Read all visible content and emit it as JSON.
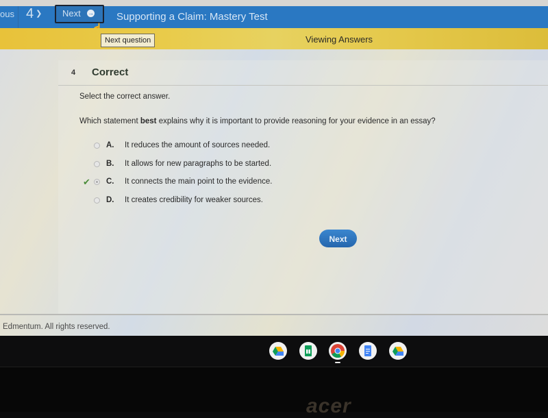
{
  "navbar": {
    "previous_label": "ous",
    "question_number": "4",
    "next_label": "Next",
    "title": "Supporting a Claim: Mastery Test",
    "tooltip": "Next question"
  },
  "banner": {
    "mode": "Viewing Answers"
  },
  "question": {
    "number": "4",
    "status": "Correct",
    "prompt": "Select the correct answer.",
    "text_before": "Which statement ",
    "text_bold": "best",
    "text_after": " explains why it is important to provide reasoning for your evidence in an essay?",
    "choices": [
      {
        "letter": "A.",
        "text": "It reduces the amount of sources needed.",
        "selected": false,
        "correct": false
      },
      {
        "letter": "B.",
        "text": "It allows for new paragraphs to be started.",
        "selected": false,
        "correct": false
      },
      {
        "letter": "C.",
        "text": "It connects the main point to the evidence.",
        "selected": true,
        "correct": true
      },
      {
        "letter": "D.",
        "text": "It creates credibility for weaker sources.",
        "selected": false,
        "correct": false
      }
    ],
    "next_button": "Next"
  },
  "footer": {
    "copyright": "Edmentum. All rights reserved."
  },
  "shelf": {
    "apps": [
      {
        "name": "google-drive-icon"
      },
      {
        "name": "google-sheets-icon"
      },
      {
        "name": "chrome-icon",
        "active": true
      },
      {
        "name": "google-docs-icon"
      },
      {
        "name": "google-drive-icon"
      }
    ]
  },
  "hardware": {
    "brand": "acer"
  },
  "colors": {
    "navbar": "#2a78c2",
    "banner": "#e8c23a",
    "next_button": "#2e73bb",
    "correct_check": "#4a8c3a"
  }
}
